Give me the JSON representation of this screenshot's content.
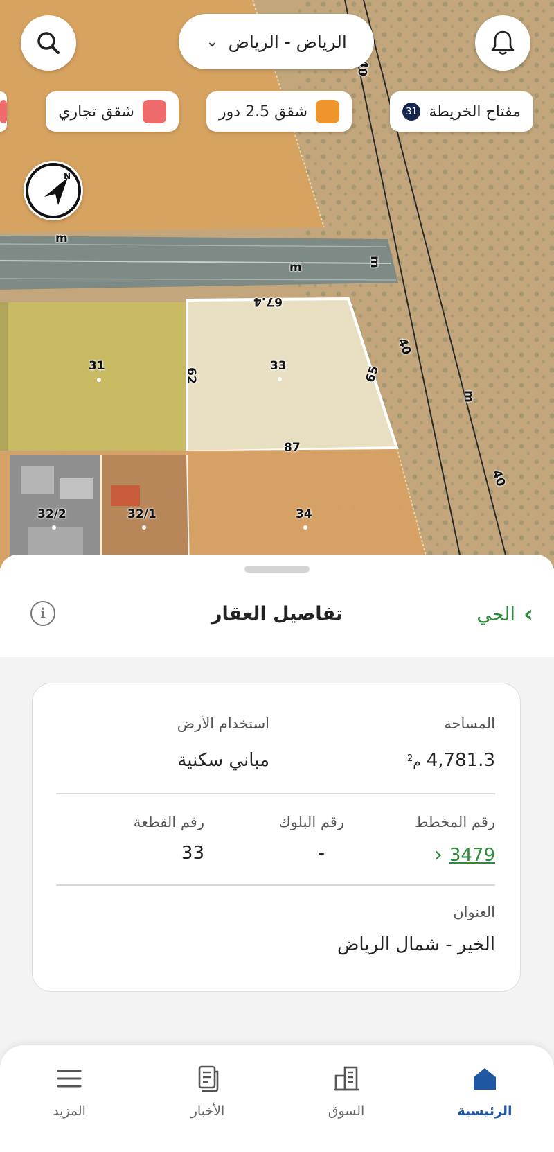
{
  "header": {
    "city_selector": "الرياض - الرياض",
    "legend": {
      "key_label": "مفتاح الخريطة",
      "key_count": "31",
      "apartments_label": "شقق 2.5 دور",
      "apartments_color": "#f0952b",
      "commercial_label": "شقق تجاري",
      "commercial_color": "#ef6b6b"
    }
  },
  "map": {
    "labels": {
      "m1": "m",
      "m2": "m",
      "m3": "m",
      "m4": "m",
      "road_40a": "40",
      "road_40b": "40",
      "road_40c": "40",
      "plot_31": "31",
      "plot_33": "33",
      "plot_34": "34",
      "plot_32_1": "32/1",
      "plot_32_2": "32/2",
      "edge_top": "67.4",
      "edge_left": "62",
      "edge_right": "65",
      "edge_bottom": "87"
    }
  },
  "sheet": {
    "title": "تفاصيل العقار",
    "back_label": "الحي",
    "info_icon": "i",
    "area_label": "المساحة",
    "area_value": "4,781.3",
    "area_unit": "م",
    "land_use_label": "استخدام الأرض",
    "land_use_value": "مباني سكنية",
    "plan_label": "رقم المخطط",
    "plan_value": "3479",
    "block_label": "رقم البلوك",
    "block_value": "-",
    "plot_label": "رقم القطعة",
    "plot_value": "33",
    "address_label": "العنوان",
    "address_value": "الخير - شمال الرياض"
  },
  "tabbar": {
    "home": "الرئيسية",
    "market": "السوق",
    "news": "الأخبار",
    "more": "المزيد"
  },
  "colors": {
    "accent_green": "#2e8b3a",
    "active_tab_blue": "#1f57a3",
    "selected_plot": "#ffffff",
    "residential_zone": "#d9a35e",
    "green_zone": "#c7bb62"
  }
}
